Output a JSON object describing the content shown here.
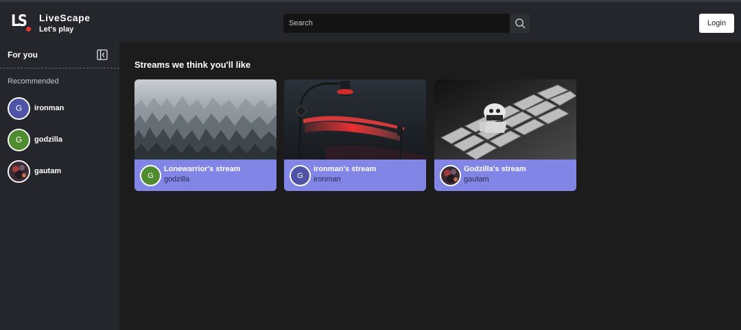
{
  "header": {
    "logo_text": "LS",
    "brand_name": "LiveScape",
    "tagline": "Let's play",
    "search_placeholder": "Search",
    "login_label": "Login"
  },
  "sidebar": {
    "title": "For you",
    "section_label": "Recommended",
    "items": [
      {
        "name": "ironman",
        "initial": "G",
        "color": "#4f54a7"
      },
      {
        "name": "godzilla",
        "initial": "G",
        "color": "#4f8b2f"
      },
      {
        "name": "gautam",
        "initial": "",
        "color": "#3b2b33"
      }
    ]
  },
  "main": {
    "section_title": "Streams we think you'll like",
    "streams": [
      {
        "title": "Lonewarrior's stream",
        "user": "godzilla",
        "initial": "G",
        "avatar_color": "#4f8b2f",
        "thumbnail": "misty-forest"
      },
      {
        "title": "ironman's stream",
        "user": "ironman",
        "initial": "G",
        "avatar_color": "#4f54a7",
        "thumbnail": "traffic-light-night"
      },
      {
        "title": "Godzilla's stream",
        "user": "gautam",
        "initial": "",
        "avatar_color": "#3b2b33",
        "thumbnail": "keyboard-figure"
      }
    ]
  },
  "colors": {
    "accent": "#8185e6",
    "topbar": "#25262b",
    "background": "#1c1c1d",
    "logo_dot": "#e53935"
  }
}
